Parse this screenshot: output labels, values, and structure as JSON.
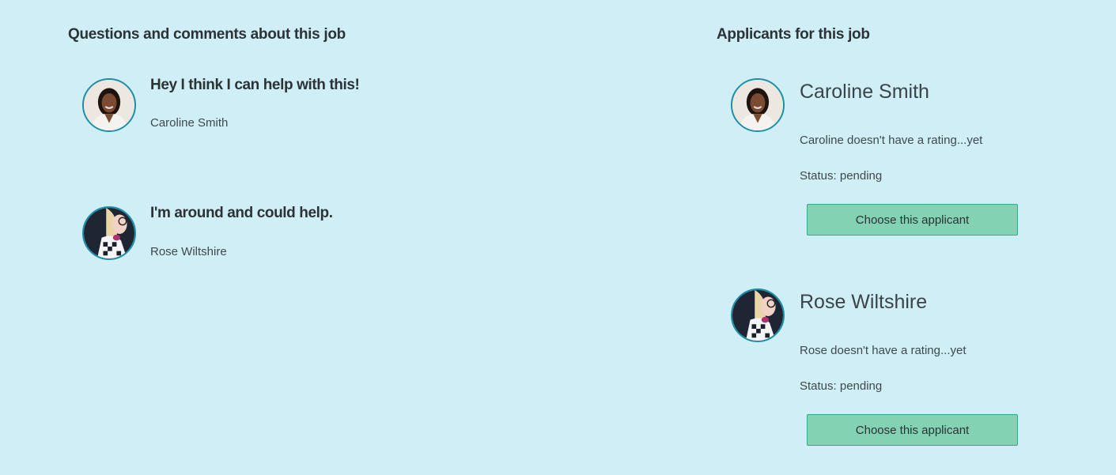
{
  "questions": {
    "title": "Questions and comments about this job",
    "items": [
      {
        "text": "Hey I think I can help with this!",
        "author": "Caroline Smith"
      },
      {
        "text": "I'm around and could help.",
        "author": "Rose Wiltshire"
      }
    ]
  },
  "applicants": {
    "title": "Applicants for this job",
    "items": [
      {
        "name": "Caroline Smith",
        "rating": "Caroline doesn't have a rating...yet",
        "status": "Status: pending",
        "button": "Choose this applicant"
      },
      {
        "name": "Rose Wiltshire",
        "rating": "Rose doesn't have a rating...yet",
        "status": "Status: pending",
        "button": "Choose this applicant"
      }
    ]
  },
  "colors": {
    "background": "#d0eef5",
    "avatar_border": "#1a8fa8",
    "button_fill": "#82d2b3",
    "button_border": "#3aa98a"
  }
}
